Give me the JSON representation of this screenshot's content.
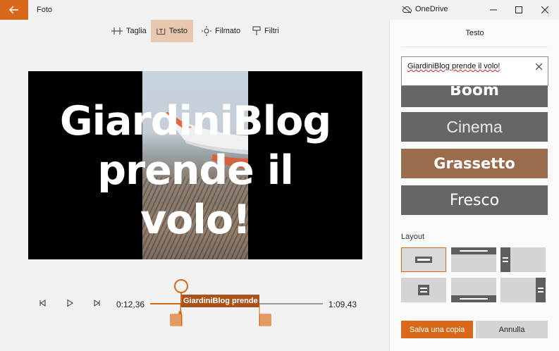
{
  "app": {
    "title": "Foto"
  },
  "titlebar": {
    "cloud_label": "OneDrive"
  },
  "toolbar": {
    "items": [
      {
        "label": "Taglia",
        "icon": "trim-icon"
      },
      {
        "label": "Testo",
        "icon": "text-icon",
        "active": true
      },
      {
        "label": "Filmato",
        "icon": "motion-icon"
      },
      {
        "label": "Filtri",
        "icon": "filter-icon"
      }
    ]
  },
  "preview": {
    "overlay_lines": [
      "GiardiniBlog",
      "prende il",
      "volo!"
    ]
  },
  "playback": {
    "current_time": "0:12,36",
    "end_time": "1:09,43",
    "clip_label": "GiardiniBlog prende il volo!"
  },
  "panel": {
    "title": "Testo",
    "text_value": "GiardiniBlog prende il volo!",
    "styles": [
      {
        "label": "Boom"
      },
      {
        "label": "Cinema"
      },
      {
        "label": "Grassetto",
        "selected": true
      },
      {
        "label": "Fresco"
      }
    ],
    "layout_label": "Layout",
    "save_label": "Salva una copia",
    "cancel_label": "Annulla"
  },
  "colors": {
    "accent": "#d9691a",
    "accent_dark": "#a8521c",
    "selected_style": "#9b6c4b",
    "style_tile": "#666666"
  }
}
